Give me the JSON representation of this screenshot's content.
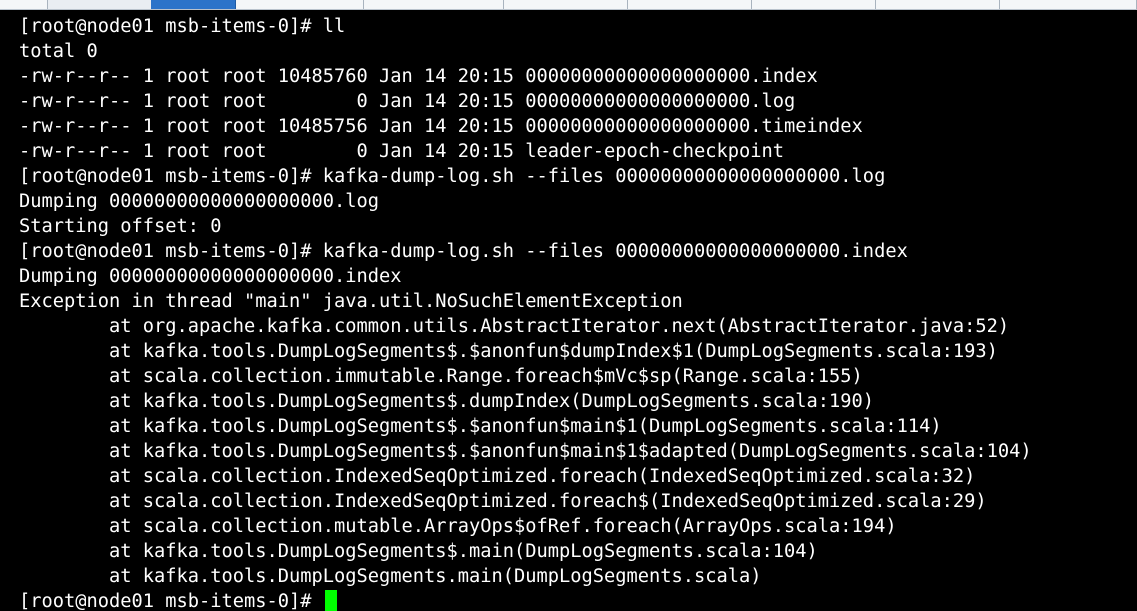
{
  "window": {
    "tabs_visible": 9,
    "active_tab_index": 1,
    "colors": {
      "background": "#000000",
      "foreground": "#ffffff",
      "cursor": "#00ff00",
      "active_tab": "#2b73c9",
      "inactive_tab": "#f4f6f8"
    }
  },
  "terminal": {
    "lines": [
      "[root@node01 msb-items-0]# ll",
      "total 0",
      "-rw-r--r-- 1 root root 10485760 Jan 14 20:15 00000000000000000000.index",
      "-rw-r--r-- 1 root root        0 Jan 14 20:15 00000000000000000000.log",
      "-rw-r--r-- 1 root root 10485756 Jan 14 20:15 00000000000000000000.timeindex",
      "-rw-r--r-- 1 root root        0 Jan 14 20:15 leader-epoch-checkpoint",
      "[root@node01 msb-items-0]# kafka-dump-log.sh --files 00000000000000000000.log",
      "Dumping 00000000000000000000.log",
      "Starting offset: 0",
      "[root@node01 msb-items-0]# kafka-dump-log.sh --files 00000000000000000000.index",
      "Dumping 00000000000000000000.index",
      "Exception in thread \"main\" java.util.NoSuchElementException",
      "        at org.apache.kafka.common.utils.AbstractIterator.next(AbstractIterator.java:52)",
      "        at kafka.tools.DumpLogSegments$.$anonfun$dumpIndex$1(DumpLogSegments.scala:193)",
      "        at scala.collection.immutable.Range.foreach$mVc$sp(Range.scala:155)",
      "        at kafka.tools.DumpLogSegments$.dumpIndex(DumpLogSegments.scala:190)",
      "        at kafka.tools.DumpLogSegments$.$anonfun$main$1(DumpLogSegments.scala:114)",
      "        at kafka.tools.DumpLogSegments$.$anonfun$main$1$adapted(DumpLogSegments.scala:104)",
      "        at scala.collection.IndexedSeqOptimized.foreach(IndexedSeqOptimized.scala:32)",
      "        at scala.collection.IndexedSeqOptimized.foreach$(IndexedSeqOptimized.scala:29)",
      "        at scala.collection.mutable.ArrayOps$ofRef.foreach(ArrayOps.scala:194)",
      "        at kafka.tools.DumpLogSegments$.main(DumpLogSegments.scala:104)",
      "        at kafka.tools.DumpLogSegments.main(DumpLogSegments.scala)"
    ],
    "current_prompt": "[root@node01 msb-items-0]# "
  }
}
